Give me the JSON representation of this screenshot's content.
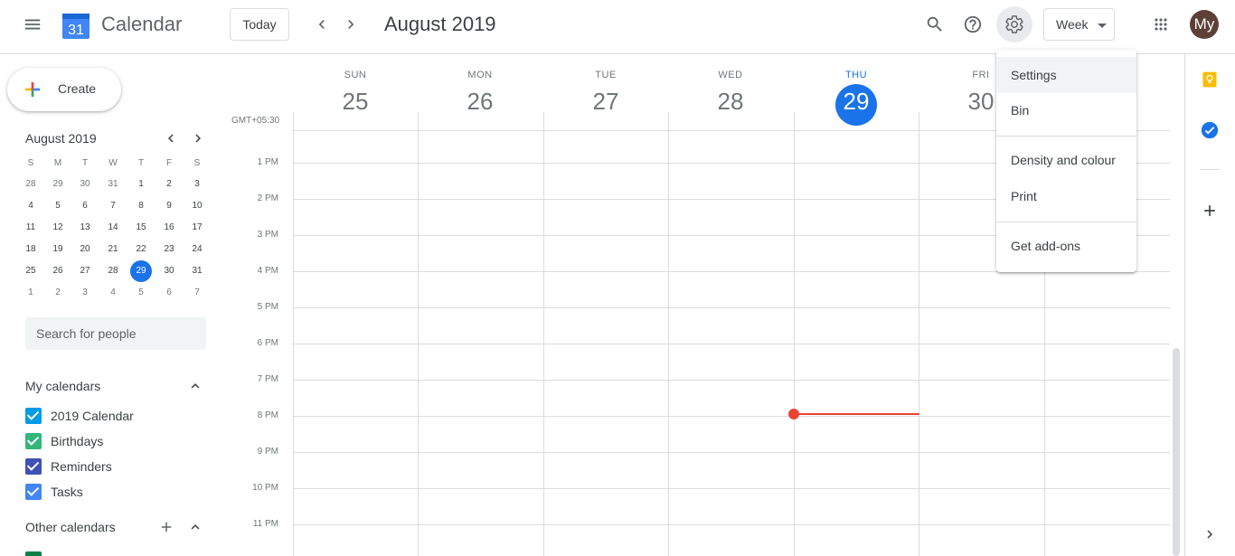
{
  "header": {
    "app_title": "Calendar",
    "logo_day": "31",
    "today_label": "Today",
    "current_range": "August 2019",
    "view_label": "Week",
    "avatar_initials": "My",
    "icons": [
      "main-menu-icon",
      "prev-icon",
      "next-icon",
      "search-icon",
      "help-icon",
      "settings-icon",
      "apps-icon"
    ]
  },
  "sidebar": {
    "create_label": "Create",
    "mini_calendar": {
      "title": "August 2019",
      "weekdays": [
        "S",
        "M",
        "T",
        "W",
        "T",
        "F",
        "S"
      ],
      "weeks": [
        [
          "28",
          "29",
          "30",
          "31",
          "1",
          "2",
          "3"
        ],
        [
          "4",
          "5",
          "6",
          "7",
          "8",
          "9",
          "10"
        ],
        [
          "11",
          "12",
          "13",
          "14",
          "15",
          "16",
          "17"
        ],
        [
          "18",
          "19",
          "20",
          "21",
          "22",
          "23",
          "24"
        ],
        [
          "25",
          "26",
          "27",
          "28",
          "29",
          "30",
          "31"
        ],
        [
          "1",
          "2",
          "3",
          "4",
          "5",
          "6",
          "7"
        ]
      ],
      "today": "29"
    },
    "search_placeholder": "Search for people",
    "my_calendars_title": "My calendars",
    "my_calendars": [
      {
        "name": "2019 Calendar",
        "color": "#039be5"
      },
      {
        "name": "Birthdays",
        "color": "#33b679"
      },
      {
        "name": "Reminders",
        "color": "#3f51b5"
      },
      {
        "name": "Tasks",
        "color": "#4285f4"
      }
    ],
    "other_calendars_title": "Other calendars"
  },
  "grid": {
    "timezone": "GMT+05:30",
    "days": [
      {
        "name": "SUN",
        "num": "25"
      },
      {
        "name": "MON",
        "num": "26"
      },
      {
        "name": "TUE",
        "num": "27"
      },
      {
        "name": "WED",
        "num": "28"
      },
      {
        "name": "THU",
        "num": "29",
        "today": true
      },
      {
        "name": "FRI",
        "num": "30"
      }
    ],
    "hours": [
      "1 PM",
      "2 PM",
      "3 PM",
      "4 PM",
      "5 PM",
      "6 PM",
      "7 PM",
      "8 PM",
      "9 PM",
      "10 PM",
      "11 PM"
    ]
  },
  "settings_menu": {
    "items": [
      "Settings",
      "Bin",
      "Density and colour",
      "Print",
      "Get add-ons"
    ],
    "highlighted": "Settings"
  },
  "colors": {
    "accent": "#1a73e8",
    "now_indicator": "#ea4335",
    "keep": "#fbbc04",
    "tasks": "#1a73e8"
  }
}
